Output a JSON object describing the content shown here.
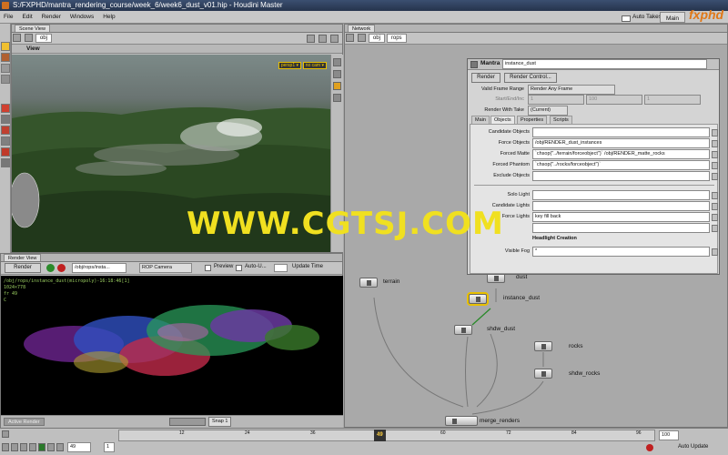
{
  "app": {
    "title": "S:/FXPHD/mantra_rendering_course/week_6/week6_dust_v01.hip - Houdini Master"
  },
  "menu": [
    "File",
    "Edit",
    "Render",
    "Windows",
    "Help"
  ],
  "topbar": {
    "auto_takes": "Auto Takes",
    "desk": "Main"
  },
  "watermark": {
    "text": "WWW.CGTSJ.COM",
    "logo": "fxphd"
  },
  "scene_view": {
    "tab": "Scene View",
    "path": "obj",
    "view_label": "View",
    "persp": "persp1 ▾",
    "cam": "no cam ▾"
  },
  "render_view": {
    "tab": "Render View",
    "render_btn": "Render",
    "rop_path": "/obj/rops/insta...",
    "camera": "ROP Camera",
    "preview": "Preview",
    "auto_update": "Auto-U...",
    "update_time": "Update Time",
    "info": [
      "/obj/rops/instance_dust(micropoly)-16:18:46[1]",
      "1024×778",
      "fr 49",
      "C"
    ],
    "active_render": "Active Render",
    "snap": "Snap 1"
  },
  "network": {
    "tab": "Network",
    "path_obj": "obj",
    "path_rops": "rops"
  },
  "parm": {
    "type": "Mantra",
    "name": "instance_dust",
    "render_btn": "Render",
    "render_ctl_btn": "Render Control...",
    "valid_frame_label": "Valid Frame Range",
    "valid_frame_value": "Render Any Frame",
    "start_end_label": "Start/End/Inc",
    "start_vals": [
      "1",
      "100",
      "1"
    ],
    "render_take_label": "Render With Take",
    "render_take_value": "(Current)",
    "tabs": [
      "Main",
      "Objects",
      "Properties",
      "Scripts"
    ],
    "candidate_objects": "Candidate Objects",
    "force_objects": "Force Objects",
    "force_objects_val": "/obj/RENDER_dust_instances",
    "forced_matte": "Forced Matte",
    "forced_matte_val": "`chsop(\"../terrain/forceobject\")` /obj/RENDER_matte_rocks",
    "forced_phantom": "Forced Phantom",
    "forced_phantom_val": "`chsop(\"../rocks/forceobject\")`",
    "exclude_objects": "Exclude Objects",
    "solo_light": "Solo Light",
    "candidate_lights": "Candidate Lights",
    "force_lights": "Force Lights",
    "force_lights_val": "key fill back",
    "headlight": "Headlight Creation",
    "visible_fog": "Visible Fog",
    "visible_fog_val": "*"
  },
  "nodes": {
    "terrain": "terrain",
    "dust": "dust",
    "instance_dust": "instance_dust",
    "shdw_dust": "shdw_dust",
    "rocks": "rocks",
    "shdw_rocks": "shdw_rocks",
    "merge_renders": "merge_renders"
  },
  "timeline": {
    "ticks": [
      "12",
      "24",
      "36",
      "48",
      "60",
      "72",
      "84",
      "96"
    ],
    "current_frame": "49",
    "frame_field": "49",
    "step": "1",
    "end": "100",
    "auto_update": "Auto Update"
  },
  "colors": {
    "accent": "#d07020",
    "node_selected": "#e8c000",
    "terrain_green": "#2f4a25"
  }
}
